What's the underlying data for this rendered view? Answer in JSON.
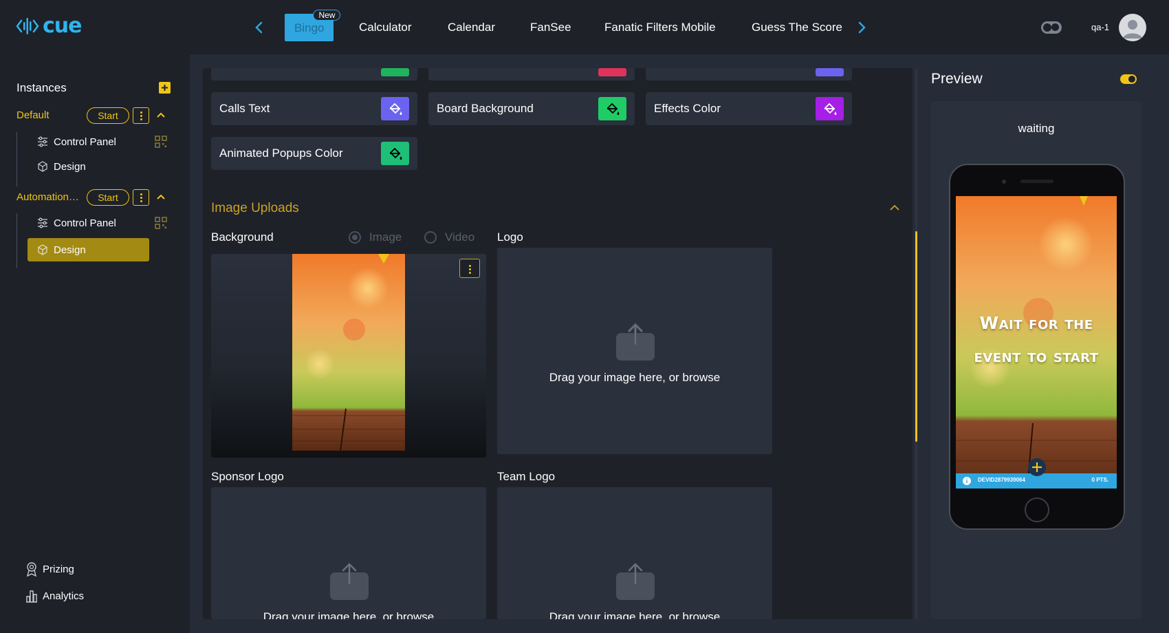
{
  "app": {
    "logo_text": "cue",
    "brand_color": "#2fb4ec",
    "accent_color": "#f0c419"
  },
  "topbar": {
    "tabs": [
      {
        "label": "Bingo",
        "badge": "New",
        "active": true
      },
      {
        "label": "Calculator"
      },
      {
        "label": "Calendar"
      },
      {
        "label": "FanSee"
      },
      {
        "label": "Fanatic Filters Mobile"
      },
      {
        "label": "Guess The Score"
      }
    ],
    "user": "qa-1"
  },
  "sidebar": {
    "title": "Instances",
    "instances": [
      {
        "name": "Default",
        "start_label": "Start",
        "items": [
          "Control Panel",
          "Design"
        ]
      },
      {
        "name": "Automation_...",
        "start_label": "Start",
        "items": [
          "Control Panel",
          "Design"
        ],
        "active_item": "Design"
      }
    ],
    "bottom": [
      "Prizing",
      "Analytics"
    ]
  },
  "main": {
    "colors": [
      {
        "label": "Calls Text",
        "color": "#6b63f0"
      },
      {
        "label": "Board Background",
        "color": "#1fcc66"
      },
      {
        "label": "Effects Color",
        "color": "#a51fe6"
      },
      {
        "label": "Animated Popups Color",
        "color": "#1fbf78"
      }
    ],
    "partial_top_swatches": [
      "#20b35d",
      "#e0335c",
      "#6b63f0"
    ],
    "image_uploads": {
      "title": "Image Uploads",
      "background_label": "Background",
      "radio_image": "Image",
      "radio_video": "Video",
      "logo_label": "Logo",
      "sponsor_label": "Sponsor Logo",
      "team_label": "Team Logo",
      "drop_text": "Drag your image here, or browse"
    }
  },
  "preview": {
    "title": "Preview",
    "status": "waiting",
    "wait_line1": "Wait for the",
    "wait_line2": "event to start",
    "device_id": "DEVID2879939064",
    "points": "0 PTS."
  }
}
